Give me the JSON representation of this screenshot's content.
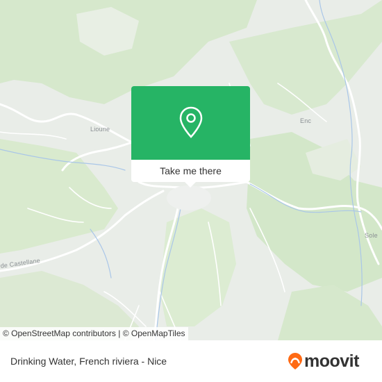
{
  "map": {
    "place_labels": [
      "Lioune",
      "Enc",
      "Sole",
      "de Castellane"
    ],
    "popup": {
      "action_label": "Take me there",
      "pin_icon": "map-pin-icon",
      "accent_color": "#26b465"
    },
    "attribution": {
      "osm_link": "© OpenStreetMap contributors",
      "separator": "|",
      "omt_link": "© OpenMapTiles"
    }
  },
  "footer": {
    "title": "Drinking Water, French riviera - Nice",
    "logo_text": "moovit",
    "logo_icon": "moovit-logo-icon",
    "logo_color": "#ff6a13"
  }
}
